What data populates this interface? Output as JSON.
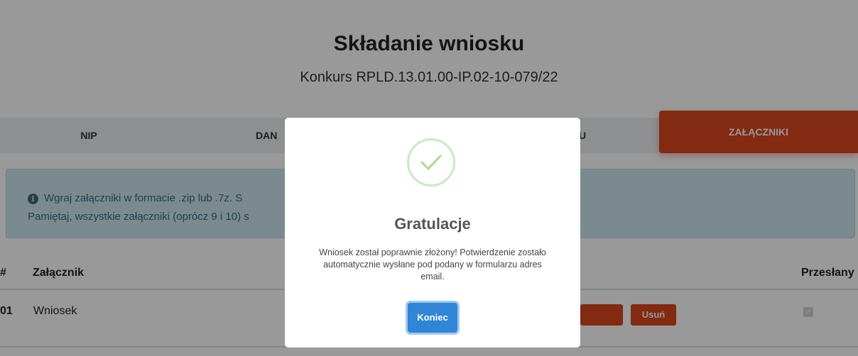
{
  "page": {
    "title": "Składanie wniosku",
    "subtitle": "Konkurs RPLD.13.01.00-IP.02-10-079/22"
  },
  "steps": {
    "nip": "NIP",
    "dane_partial": "DAN",
    "hidden_partial": "U",
    "attachments": "ZAŁĄCZNIKI"
  },
  "info": {
    "icon": "info-icon",
    "line1": "Wgraj załączniki w formacie .zip lub .7z. S",
    "line2": "Pamiętaj, wszystkie załączniki (oprócz 9 i 10) s"
  },
  "table": {
    "headers": {
      "num": "#",
      "attachment": "Załącznik",
      "sent": "Przesłany"
    },
    "rows": [
      {
        "num": "01",
        "name": "Wniosek",
        "delete_label": "Usuń",
        "sent": true
      }
    ]
  },
  "modal": {
    "icon": "success-check-icon",
    "title": "Gratulacje",
    "message": "Wniosek został poprawnie złożony! Potwierdzenie zostało automatycznie wysłane pod podany w formularzu adres email.",
    "confirm_label": "Koniec"
  },
  "colors": {
    "accent": "#d9471f",
    "primary_button": "#3085d6",
    "success": "#a5dc86",
    "info_bg": "#cde6ef"
  }
}
